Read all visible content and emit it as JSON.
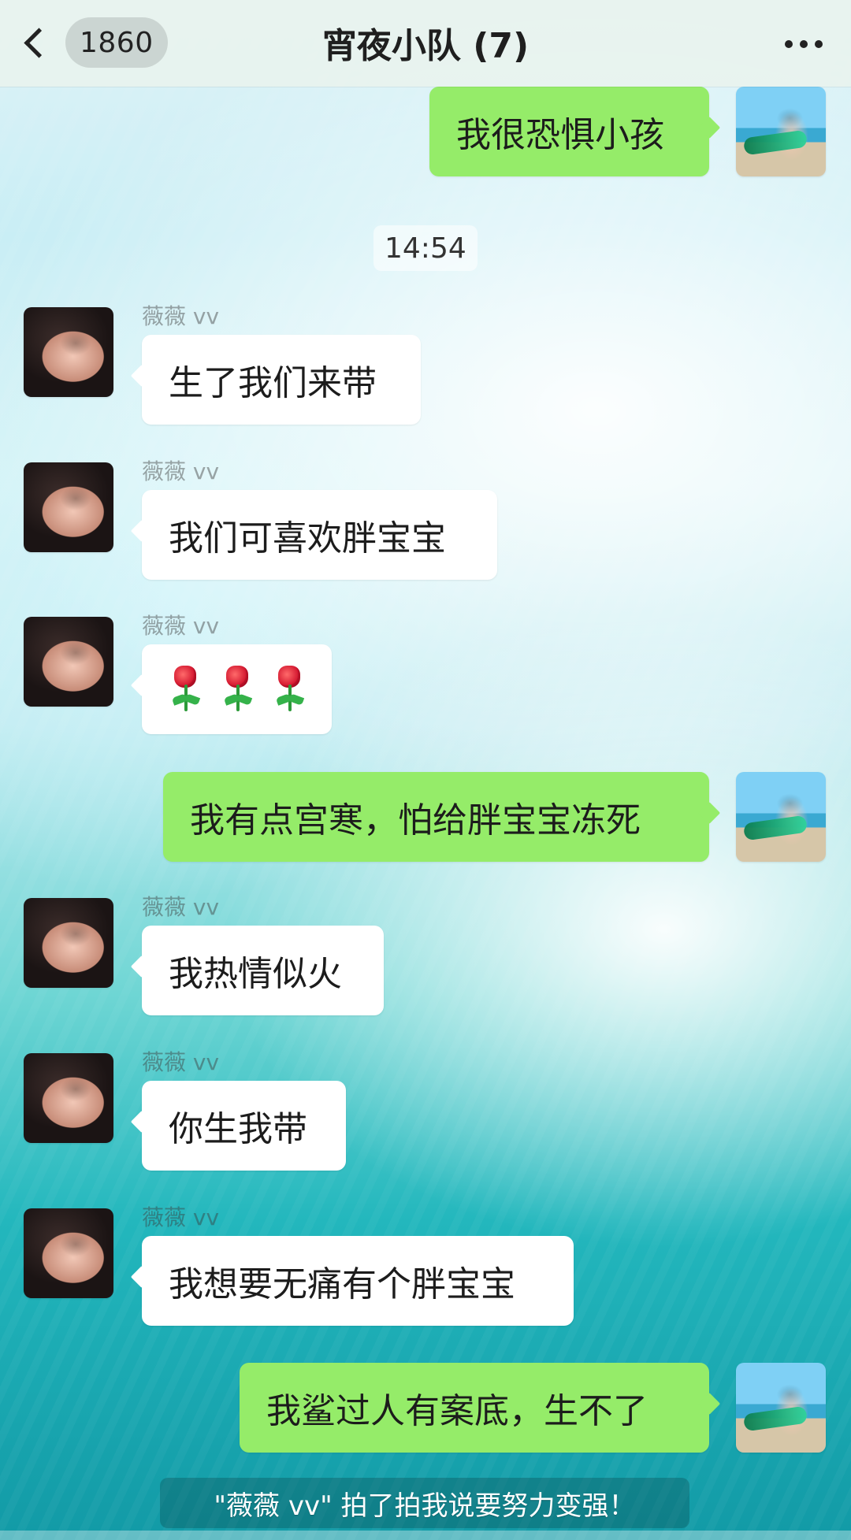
{
  "header": {
    "unread_count": "1860",
    "title": "宵夜小队 (7)",
    "back_icon": "chevron-left-icon",
    "more_icon": "more-dots-icon"
  },
  "chat": {
    "timestamp": "14:54",
    "messages": [
      {
        "side": "right",
        "text": "我很恐惧小孩"
      },
      {
        "side": "left",
        "sender": "薇薇 vv",
        "text": "生了我们来带"
      },
      {
        "side": "left",
        "sender": "薇薇 vv",
        "text": "我们可喜欢胖宝宝"
      },
      {
        "side": "left",
        "sender": "薇薇 vv",
        "emoji_sequence": [
          "rose-icon",
          "rose-icon",
          "rose-icon"
        ]
      },
      {
        "side": "right",
        "text": "我有点宫寒，怕给胖宝宝冻死"
      },
      {
        "side": "left",
        "sender": "薇薇 vv",
        "text": "我热情似火"
      },
      {
        "side": "left",
        "sender": "薇薇 vv",
        "text": "你生我带"
      },
      {
        "side": "left",
        "sender": "薇薇 vv",
        "text": "我想要无痛有个胖宝宝"
      },
      {
        "side": "right",
        "text": "我鲨过人有案底，生不了"
      }
    ],
    "system_notice": "\"薇薇 vv\" 拍了拍我说要努力变强！"
  },
  "colors": {
    "self_bubble": "#95ec69",
    "other_bubble": "#ffffff",
    "topbar_bg": "#e8f3ee"
  }
}
